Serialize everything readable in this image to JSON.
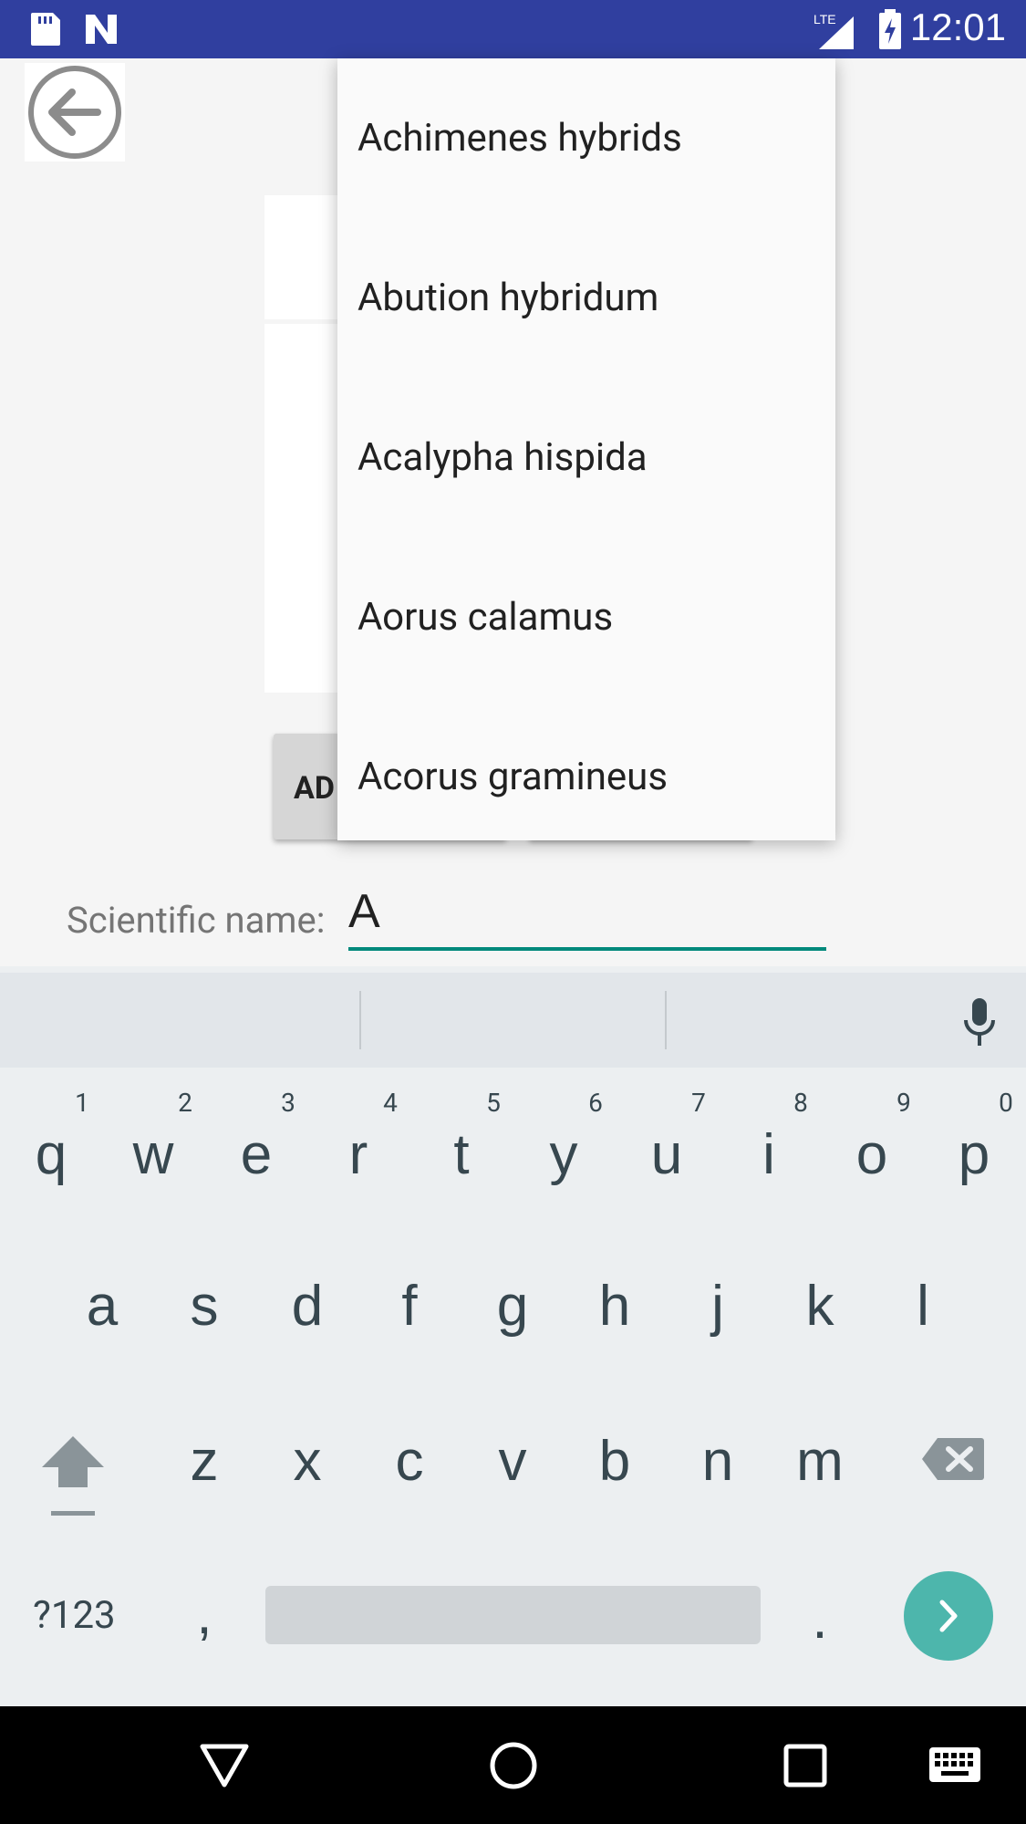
{
  "status_bar": {
    "time": "12:01",
    "network": "LTE"
  },
  "dropdown": {
    "items": [
      "Achimenes hybrids",
      "Abution hybridum",
      "Acalypha hispida",
      "Aorus calamus",
      "Acorus gramineus"
    ]
  },
  "buttons": {
    "add_label": "AD"
  },
  "form": {
    "scientific_label": "Scientific name:",
    "scientific_value": "A"
  },
  "keyboard": {
    "row1": [
      "q",
      "w",
      "e",
      "r",
      "t",
      "y",
      "u",
      "i",
      "o",
      "p"
    ],
    "row1_hints": [
      "1",
      "2",
      "3",
      "4",
      "5",
      "6",
      "7",
      "8",
      "9",
      "0"
    ],
    "row2": [
      "a",
      "s",
      "d",
      "f",
      "g",
      "h",
      "j",
      "k",
      "l"
    ],
    "row3": [
      "z",
      "x",
      "c",
      "v",
      "b",
      "n",
      "m"
    ],
    "symbols_label": "?123",
    "comma": ",",
    "period": "."
  },
  "colors": {
    "status_bar": "#303f9f",
    "accent": "#00897b",
    "go_button": "#4db6ac"
  }
}
